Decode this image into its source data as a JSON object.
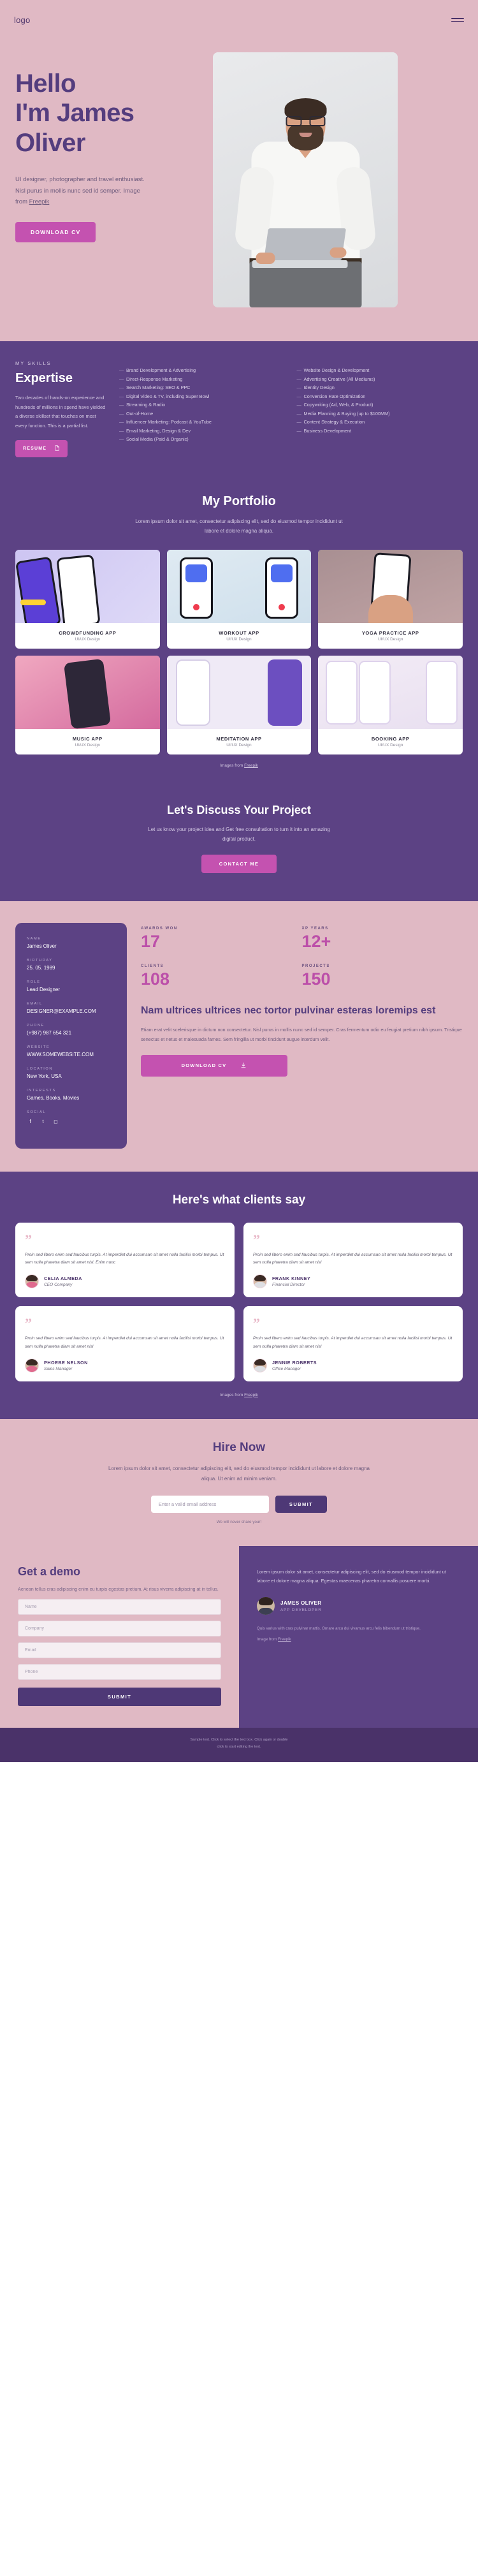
{
  "header": {
    "logo": "logo",
    "menu_icon": "hamburger-menu"
  },
  "hero": {
    "title_line1": "Hello",
    "title_line2": "I'm James",
    "title_line3": "Oliver",
    "paragraph": "UI designer, photographer and travel enthusiast. Nisl purus in mollis nunc sed id semper.  Image from ",
    "credit_link": "Freepik",
    "cta": "DOWNLOAD CV",
    "bg_color": "#e0b9c4",
    "accent": "#c452b0"
  },
  "skills": {
    "eyebrow": "MY SKILLS",
    "title": "Expertise",
    "paragraph": "Two decades of hands-on experience and hundreds of millions in spend have yielded a diverse skillset that touches on most every function. This is a partial list.",
    "resume_button": "RESUME",
    "column1": [
      "Brand Development & Advertising",
      "Direct-Response Marketing",
      "Search Marketing: SEO & PPC",
      "Digital Video & TV, including Super Bowl",
      "Streaming & Radio",
      "Out-of-Home",
      "Influencer Marketing: Podcast & YouTube",
      "Email Marketing, Design & Dev",
      "Social Media (Paid & Organic)"
    ],
    "column2": [
      "Website Design & Development",
      "Advertising Creative (All Mediums)",
      "Identity Design",
      "Conversion Rate Optimization",
      "Copywriting (Ad, Web, & Product)",
      "Media Planning & Buying (up to $100MM)",
      "Content Strategy & Execution",
      "Business Development"
    ]
  },
  "portfolio": {
    "title": "My Portfolio",
    "subtitle": "Lorem ipsum dolor sit amet, consectetur adipiscing elit, sed do eiusmod tempor incididunt ut labore et dolore magna aliqua.",
    "items": [
      {
        "name": "CROWDFUNDING APP",
        "category": "UI/UX Design"
      },
      {
        "name": "WORKOUT APP",
        "category": "UI/UX Design"
      },
      {
        "name": "YOGA PRACTICE APP",
        "category": "UI/UX Design"
      },
      {
        "name": "MUSIC APP",
        "category": "UI/UX Design"
      },
      {
        "name": "MEDITATION APP",
        "category": "UI/UX Design"
      },
      {
        "name": "BOOKING  APP",
        "category": "UI/UX Design"
      }
    ],
    "credit_prefix": "Images from ",
    "credit_link": "Freepik"
  },
  "discuss": {
    "title": "Let's Discuss Your Project",
    "paragraph": "Let us know your project idea and Get free consultation to turn it into an amazing digital product.",
    "cta": "CONTACT ME"
  },
  "profile": {
    "info": [
      {
        "label": "NAME",
        "value": "James Oliver"
      },
      {
        "label": "BIRTHDAY",
        "value": "25. 05. 1989"
      },
      {
        "label": "ROLE",
        "value": "Lead Designer"
      },
      {
        "label": "EMAIL",
        "value": "DESIGNER@EXAMPLE.COM"
      },
      {
        "label": "PHONE",
        "value": "(+987) 987 654 321"
      },
      {
        "label": "WEBSITE",
        "value": "WWW.SOMEWEBSITE.COM"
      },
      {
        "label": "LOCATION",
        "value": "New York, USA"
      },
      {
        "label": "INTERESTS",
        "value": "Games, Books, Movies"
      }
    ],
    "social_label": "SOCIAL",
    "socials": [
      "facebook-icon",
      "twitter-icon",
      "instagram-icon"
    ],
    "stats": [
      {
        "label": "AWARDS WON",
        "value": "17"
      },
      {
        "label": "XP YEARS",
        "value": "12+"
      },
      {
        "label": "CLIENTS",
        "value": "108"
      },
      {
        "label": "PROJECTS",
        "value": "150"
      }
    ],
    "heading": "Nam ultrices ultrices nec tortor pulvinar esteras loremips est",
    "paragraph": "Etiam erat velit scelerisque in dictum non consectetur. Nisl purus in mollis nunc sed id semper. Cras fermentum odio eu feugiat pretium nibh ipsum. Tristique senectus et netus et malesuada fames. Sem fringilla ut morbi tincidunt augue interdum velit.",
    "cta": "DOWNLOAD CV"
  },
  "testimonials": {
    "title": "Here's what clients say",
    "quote_glyph": "”",
    "items": [
      {
        "text": "Proin sed libero enim sed faucibus turpis. At imperdiet dui accumsan sit amet nulla facilisi morbi tempus. Ut sem nulla pharetra diam sit amet nisl. Enim nunc",
        "name": "CELIA ALMEDA",
        "role": "CEO Company"
      },
      {
        "text": "Proin sed libero enim sed faucibus turpis. At imperdiet dui accumsan sit amet nulla facilisi morbi tempus. Ut sem nulla pharetra diam sit amet nisl",
        "name": "FRANK KINNEY",
        "role": "Financial Director"
      },
      {
        "text": "Proin sed libero enim sed faucibus turpis. At imperdiet dui accumsan sit amet nulla facilisi morbi tempus. Ut sem nulla pharetra diam sit amet nisl",
        "name": "PHOEBE NELSON",
        "role": "Sales Manager"
      },
      {
        "text": "Proin sed libero enim sed faucibus turpis. At imperdiet dui accumsan sit amet nulla facilisi morbi tempus. Ut sem nulla pharetra diam sit amet nisl",
        "name": "JENNIE ROBERTS",
        "role": "Office Manager"
      }
    ],
    "credit_prefix": "Images from ",
    "credit_link": "Freepik"
  },
  "hire": {
    "title": "Hire Now",
    "paragraph": "Lorem ipsum dolor sit amet, consectetur adipiscing elit, sed do eiusmod tempor incididunt ut labore et dolore magna aliqua. Ut enim ad minim veniam.",
    "email_placeholder": "Enter a valid email address",
    "submit": "SUBMIT",
    "note": "We will never share your!"
  },
  "demo": {
    "title": "Get a demo",
    "paragraph": "Aenean tellus cras adipiscing enim eu turpis egestas pretium. At risus viverra adipiscing at in tellus.",
    "fields": [
      {
        "placeholder": "Name"
      },
      {
        "placeholder": "Company"
      },
      {
        "placeholder": "Email"
      },
      {
        "placeholder": "Phone"
      }
    ],
    "submit": "SUBMIT",
    "right_paragraph": "Lorem ipsum dolor sit amet, consectetur adipiscing elit, sed do eiusmod tempor incididunt ut labore et dolore magna aliqua. Egestas maecenas pharetra convallis posuere morbi.",
    "person_name": "JAMES OLIVER",
    "person_role": "APP DEVELOPER",
    "small_text": "Quis varius with cras pulvinar mattis. Ornare arcu dui vivamus arcu felis bibendum ut tristique.",
    "credit_prefix": "Image from ",
    "credit_link": "Freepik"
  },
  "footer": {
    "line1": "Sample text. Click to select the text box. Click again or double",
    "line2": "click to start editing the text."
  }
}
